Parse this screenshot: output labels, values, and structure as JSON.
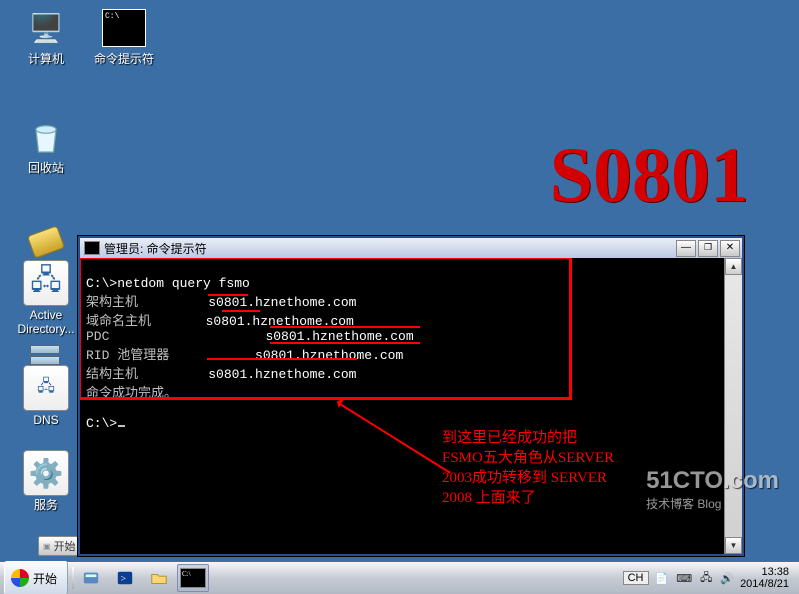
{
  "desktop": {
    "icons": [
      {
        "name": "computer",
        "label": "计算机"
      },
      {
        "name": "cmd",
        "label": "命令提示符"
      },
      {
        "name": "recycle",
        "label": "回收站"
      },
      {
        "name": "ad",
        "label": "Active\nDirectory..."
      },
      {
        "name": "dns",
        "label": "DNS"
      },
      {
        "name": "services",
        "label": "服务"
      }
    ]
  },
  "watermarks": {
    "main": "S0801",
    "brand": "51CTO.com",
    "brand_sub": "技术博客 Blog"
  },
  "window": {
    "title": "管理员: 命令提示符",
    "prompt1": "C:\\>",
    "command": "netdom query fsmo",
    "rows": [
      {
        "role": "架构主机",
        "host": "s0801.hznethome.com"
      },
      {
        "role": "域命名主机",
        "host": "s0801.hznethome.com"
      },
      {
        "role": "PDC",
        "host": "s0801.hznethome.com"
      },
      {
        "role": "RID 池管理器",
        "host": "s0801.hznethome.com"
      },
      {
        "role": "结构主机",
        "host": "s0801.hznethome.com"
      }
    ],
    "done": "命令成功完成。",
    "prompt2": "C:\\>"
  },
  "annotation": "到这里已经成功的把\nFSMO五大角色从SERVER\n2003成功转移到 SERVER\n2008 上面来了",
  "mini_start_label": "开始",
  "taskbar": {
    "start": "开始",
    "buttons": [
      {
        "name": "server-manager-icon"
      },
      {
        "name": "powershell-icon"
      },
      {
        "name": "explorer-icon"
      },
      {
        "name": "cmd-icon",
        "active": true
      }
    ],
    "ime": "CH",
    "tray_icons": [
      "document-icon",
      "input-icon",
      "network-icon",
      "sound-icon"
    ],
    "clock": {
      "time": "13:38",
      "date": "2014/8/21"
    }
  }
}
